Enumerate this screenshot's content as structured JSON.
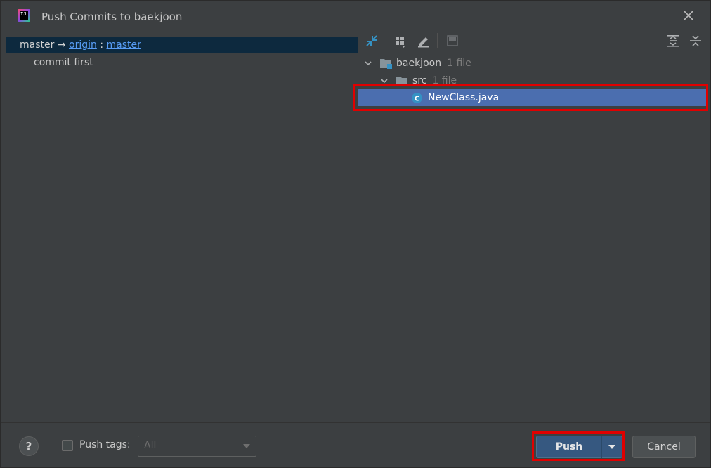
{
  "window": {
    "title": "Push Commits to baekjoon"
  },
  "left_pane": {
    "branch": {
      "local": "master",
      "arrow": "→",
      "remote": "origin",
      "separator": ":",
      "remote_branch": "master"
    },
    "commits": [
      {
        "message": "commit first"
      }
    ]
  },
  "right_pane": {
    "toolbar": {
      "icons": [
        "show-diff-icon",
        "group-by-icon",
        "edit-source-icon",
        "preview-icon",
        "expand-all-icon",
        "collapse-all-icon"
      ]
    },
    "tree": [
      {
        "label": "baekjoon",
        "count": "1 file",
        "type": "module",
        "expanded": true
      },
      {
        "label": "src",
        "count": "1 file",
        "type": "folder",
        "expanded": true
      },
      {
        "label": "NewClass.java",
        "count": "",
        "type": "java-class",
        "selected": true
      }
    ]
  },
  "footer": {
    "help_label": "?",
    "push_tags_label": "Push tags:",
    "push_tags_checked": false,
    "tags_select_value": "All",
    "push_label": "Push",
    "cancel_label": "Cancel"
  },
  "colors": {
    "dialog_bg": "#3c3f41",
    "selection": "#4b6eaf",
    "branch_row_bg": "#0d293e",
    "link": "#589df6",
    "primary_button": "#365880",
    "highlight_border": "#e00000"
  }
}
